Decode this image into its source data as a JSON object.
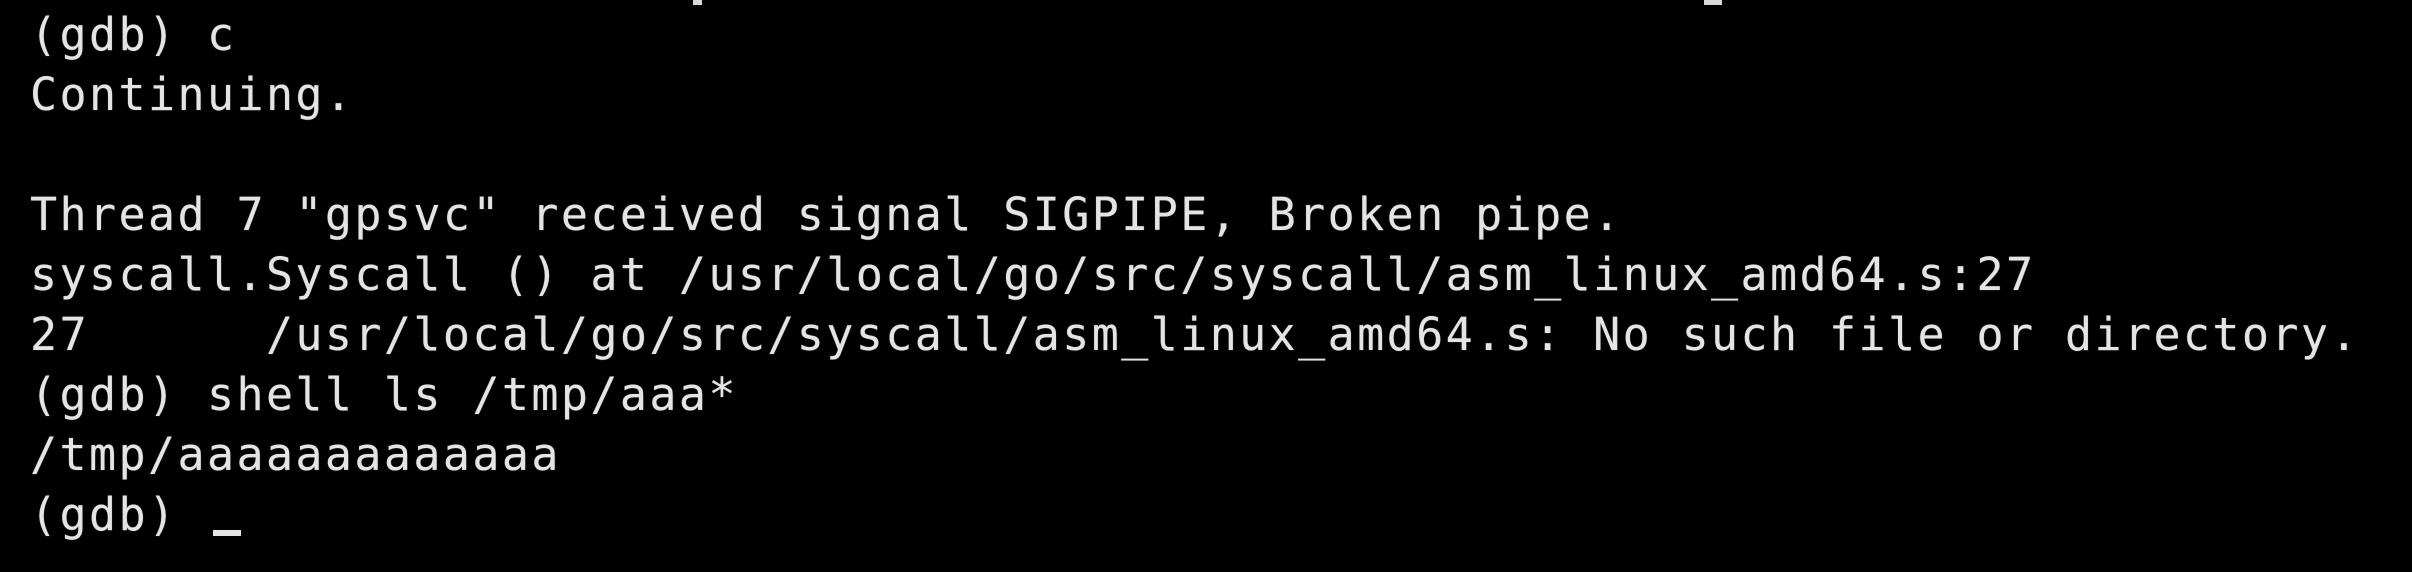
{
  "terminal": {
    "lines": [
      "(gdb) c",
      "Continuing.",
      "",
      "Thread 7 \"gpsvc\" received signal SIGPIPE, Broken pipe.",
      "syscall.Syscall () at /usr/local/go/src/syscall/asm_linux_amd64.s:27",
      "27      /usr/local/go/src/syscall/asm_linux_amd64.s: No such file or directory.",
      "(gdb) shell ls /tmp/aaa*",
      "/tmp/aaaaaaaaaaaaa",
      "(gdb) "
    ],
    "foreground_color": "#e4e4e4",
    "background_color": "#000000",
    "cursor_style": "underscore"
  }
}
